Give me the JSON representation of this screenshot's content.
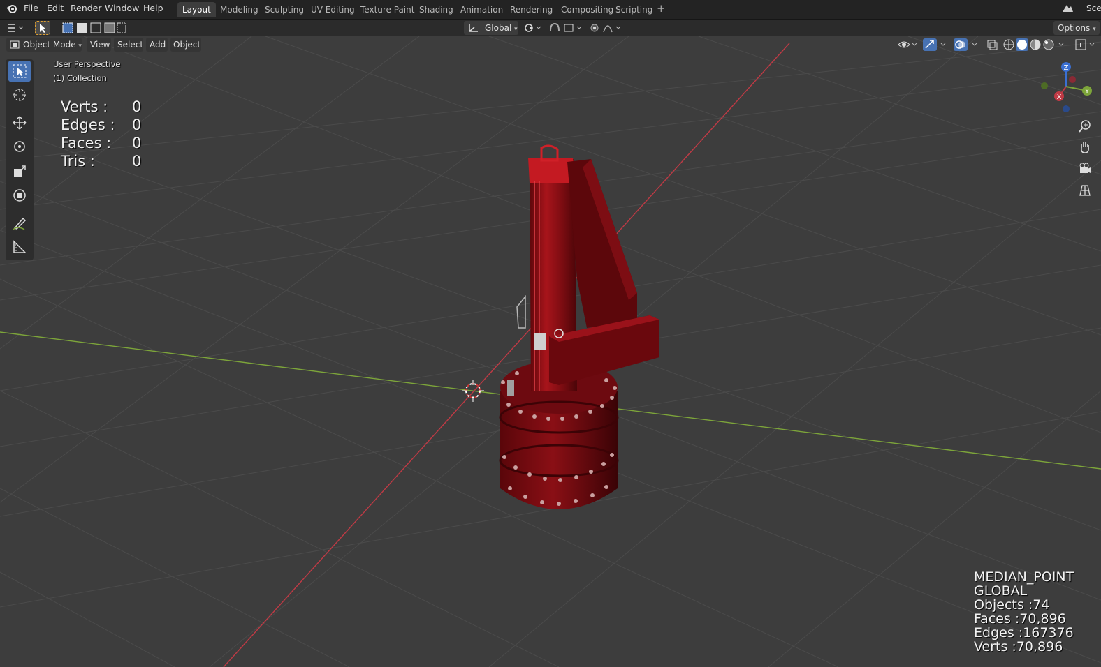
{
  "menubar": {
    "items": [
      "File",
      "Edit",
      "Render",
      "Window",
      "Help"
    ],
    "workspace_tabs": [
      "Layout",
      "Modeling",
      "Sculpting",
      "UV Editing",
      "Texture Paint",
      "Shading",
      "Animation",
      "Rendering",
      "Compositing",
      "Scripting"
    ],
    "add_tab": "+",
    "scene_label": "Sce"
  },
  "tool_header": {
    "orientation": "Global",
    "options": "Options"
  },
  "viewport_header": {
    "mode": "Object Mode",
    "menus": [
      "View",
      "Select",
      "Add",
      "Object"
    ]
  },
  "overlay": {
    "perspective": "User Perspective",
    "collection": "(1) Collection",
    "stats": [
      {
        "label": "Verts :",
        "value": "0"
      },
      {
        "label": "Edges :",
        "value": "0"
      },
      {
        "label": "Faces :",
        "value": "0"
      },
      {
        "label": "Tris :",
        "value": "0"
      }
    ],
    "scene_info": {
      "pivot": "MEDIAN_POINT",
      "orientation": "GLOBAL",
      "objects": "Objects :74",
      "faces": "Faces :70,896",
      "edges": "Edges :167376",
      "verts": "Verts :70,896"
    }
  },
  "gizmo": {
    "z": "Z",
    "y": "Y",
    "x": "X"
  },
  "colors": {
    "accent": "#4772b3",
    "x_axis": "#c03a45",
    "y_axis": "#7da53a",
    "z_axis": "#3a6fd2",
    "model": "#8a0f15"
  },
  "icons": [
    "blender-logo-icon",
    "select-box-icon",
    "cursor-icon",
    "move-icon",
    "rotate-icon",
    "scale-icon",
    "transform-icon",
    "annotate-icon",
    "measure-icon",
    "zoom-icon",
    "hand-icon",
    "camera-icon",
    "grid-view-icon"
  ]
}
